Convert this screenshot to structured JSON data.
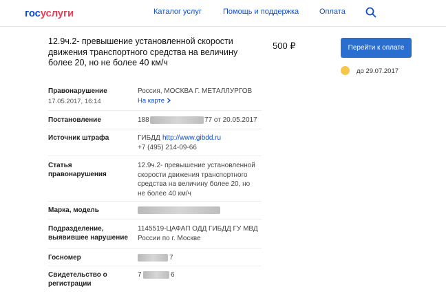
{
  "header": {
    "logo_part1": "гос",
    "logo_part2": "услуги",
    "nav": [
      "Каталог услуг",
      "Помощь и поддержка",
      "Оплата"
    ]
  },
  "fine": {
    "title": "12.9ч.2- превышение установленной скорости движения транспортного средства на величину более 20, но не более 40 км/ч",
    "amount": "500 ₽",
    "pay_button": "Перейти к оплате",
    "due": "до 29.07.2017"
  },
  "details": {
    "offense_label": "Правонарушение",
    "offense_datetime": "17.05.2017, 16:14",
    "offense_place": "Россия, МОСКВА Г. МЕТАЛЛУРГОВ",
    "map_link": "На карте",
    "decree_label": "Постановление",
    "decree_prefix": "188",
    "decree_suffix": "77 от 20.05.2017",
    "source_label": "Источник штрафа",
    "source_name": "ГИБДД",
    "source_url": "http://www.gibdd.ru",
    "source_phone": "+7 (495) 214-09-66",
    "article_label": "Статья правонарушения",
    "article_text": "12.9ч.2- превышение установленной скорости движения транспортного средства на величину более 20, но не более 40 км/ч",
    "model_label": "Марка, модель",
    "division_label": "Подразделение, выявившее нарушение",
    "division_line1": "1145519-ЦАФАП ОДД ГИБДД ГУ МВД",
    "division_line2": "России по г. Москве",
    "plate_label": "Госномер",
    "plate_suffix": "7",
    "cert_label": "Свидетельство о регистрации",
    "cert_prefix": "7",
    "cert_suffix": "6"
  }
}
